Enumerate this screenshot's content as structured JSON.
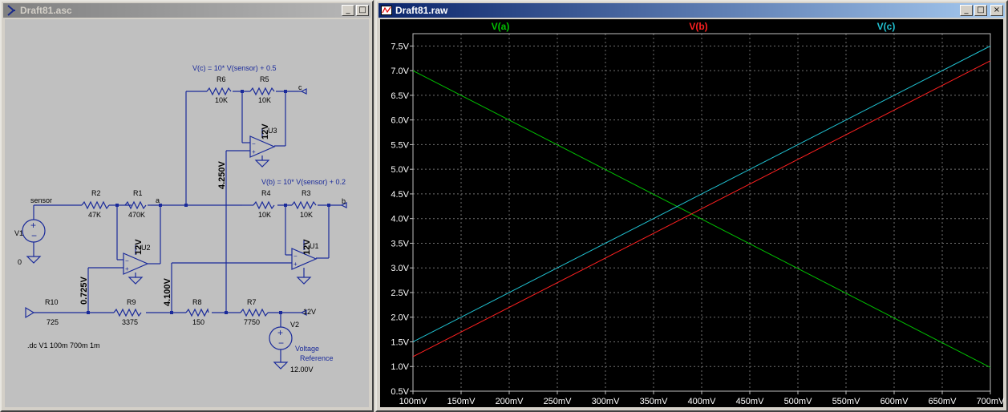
{
  "schematic_window": {
    "title": "Draft81.asc",
    "buttons": {
      "minimize": "_",
      "maximize": "□"
    }
  },
  "plot_window": {
    "title": "Draft81.raw",
    "buttons": {
      "minimize": "_",
      "maximize": "□",
      "close": "×"
    }
  },
  "schematic": {
    "formula_c": "V(c) = 10* V(sensor) + 0.5",
    "formula_b": "V(b) = 10* V(sensor) + 0.2",
    "net_sensor": "sensor",
    "net_a": "a",
    "net_b": "b",
    "net_c": "c",
    "net_12v": "12V",
    "v1": {
      "name": "V1",
      "value": "0"
    },
    "v2": {
      "name": "V2",
      "value": "12.00V",
      "label1": "Voltage",
      "label2": "Reference"
    },
    "r1": {
      "name": "R1",
      "value": "470K"
    },
    "r2": {
      "name": "R2",
      "value": "47K"
    },
    "r3": {
      "name": "R3",
      "value": "10K"
    },
    "r4": {
      "name": "R4",
      "value": "10K"
    },
    "r5": {
      "name": "R5",
      "value": "10K"
    },
    "r6": {
      "name": "R6",
      "value": "10K"
    },
    "r7": {
      "name": "R7",
      "value": "7750"
    },
    "r8": {
      "name": "R8",
      "value": "150"
    },
    "r9": {
      "name": "R9",
      "value": "3375"
    },
    "r10": {
      "name": "R10",
      "value": "725"
    },
    "u1": "U1",
    "u2": "U2",
    "u3": "U3",
    "supply_label": "12V",
    "node_4250": "4.250V",
    "node_4100": "4.100V",
    "node_0725": "0.725V",
    "directive": ".dc V1 100m 700m 1m"
  },
  "chart_data": {
    "type": "line",
    "x": [
      0.1,
      0.7
    ],
    "x_ticks": [
      "100mV",
      "150mV",
      "200mV",
      "250mV",
      "300mV",
      "350mV",
      "400mV",
      "450mV",
      "500mV",
      "550mV",
      "600mV",
      "650mV",
      "700mV"
    ],
    "y_ticks": [
      "0.5V",
      "1.0V",
      "1.5V",
      "2.0V",
      "2.5V",
      "3.0V",
      "3.5V",
      "4.0V",
      "4.5V",
      "5.0V",
      "5.5V",
      "6.0V",
      "6.5V",
      "7.0V",
      "7.5V"
    ],
    "xlim": [
      0.1,
      0.7
    ],
    "ylim": [
      0.5,
      7.75
    ],
    "grid": true,
    "legend_position": "top",
    "series": [
      {
        "name": "V(a)",
        "color": "#00c000",
        "values": [
          7.0,
          0.98
        ]
      },
      {
        "name": "V(b)",
        "color": "#ff2020",
        "values": [
          1.2,
          7.2
        ]
      },
      {
        "name": "V(c)",
        "color": "#20c0d0",
        "values": [
          1.5,
          7.5
        ]
      }
    ],
    "background": "#000000",
    "grid_color": "#707070",
    "axis_text_color": "#ffffff"
  }
}
